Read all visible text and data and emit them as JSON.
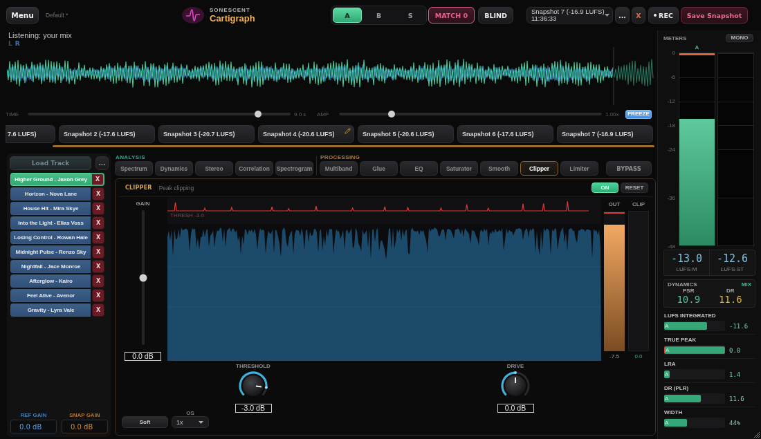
{
  "header": {
    "menu_button": "Menu",
    "preset": "Default *",
    "logo": {
      "brand": "SONESCENT",
      "product": "Cartigraph"
    },
    "compare": [
      {
        "label": "A",
        "selected": true
      },
      {
        "label": "B",
        "selected": false
      },
      {
        "label": "S",
        "selected": false
      }
    ],
    "match_button": {
      "label": "MATCH 0",
      "active": true
    },
    "blind_button": {
      "label": "BLIND",
      "active": false
    },
    "snapshot_select": {
      "value": "Snapshot 7 (-16.9 LUFS)  11:36:33"
    },
    "more_button": "...",
    "clear_button": "X",
    "rec_button": "REC",
    "save_button": "Save Snapshot"
  },
  "listening": "Listening: your mix",
  "channel_legend": [
    {
      "label": "L",
      "color": "#34566a"
    },
    {
      "label": "R",
      "color": "#3f73b8"
    }
  ],
  "transport": {
    "time": {
      "label": "TIME",
      "level": 0.876,
      "reading": "9.0 s"
    },
    "amp": {
      "label": "AMP",
      "level": 0.2,
      "reading": "1.00x"
    },
    "freeze_button": "FREEZE"
  },
  "snapshots": [
    {
      "label": "7.6 LUFS)",
      "edit_icon": false
    },
    {
      "label": "Snapshot 2 (-17.6 LUFS)",
      "edit_icon": false
    },
    {
      "label": "Snapshot 3 (-20.7 LUFS)",
      "edit_icon": false
    },
    {
      "label": "Snapshot 4 (-20.6 LUFS)",
      "edit_icon": true
    },
    {
      "label": "Snapshot 5 (-20.6 LUFS)",
      "edit_icon": false
    },
    {
      "label": "Snapshot 6 (-17.6 LUFS)",
      "edit_icon": false
    },
    {
      "label": "Snapshot 7 (-16.9 LUFS)",
      "edit_icon": false
    }
  ],
  "library": {
    "load_button": {
      "label": "Load Track",
      "disabled": true
    },
    "more_button": "...",
    "tracks": [
      {
        "title": "Higher Ground - Jaxon Grey",
        "remove": "X",
        "selected": true
      },
      {
        "title": "Horizon - Nova Lane",
        "remove": "X",
        "selected": false
      },
      {
        "title": "House Hit - Mira Skye",
        "remove": "X",
        "selected": false
      },
      {
        "title": "Into the Light - Elias Voss",
        "remove": "X",
        "selected": false
      },
      {
        "title": "Losing Control - Rowan Hale",
        "remove": "X",
        "selected": false
      },
      {
        "title": "Midnight Pulse - Renzo Sky",
        "remove": "X",
        "selected": false
      },
      {
        "title": "Nightfall - Jace Monroe",
        "remove": "X",
        "selected": false
      },
      {
        "title": "Afterglow - Kairo",
        "remove": "X",
        "selected": false
      },
      {
        "title": "Feel Alive - Avenor",
        "remove": "X",
        "selected": false
      },
      {
        "title": "Gravity - Lyra Vale",
        "remove": "X",
        "selected": false
      }
    ],
    "ref_gain": {
      "label": "REF GAIN",
      "value": "0.0 dB"
    },
    "snap_gain": {
      "label": "SNAP GAIN",
      "value": "0.0 dB"
    }
  },
  "analysis": {
    "label": "ANALYSIS",
    "tabs": [
      {
        "label": "Spectrum",
        "selected": false
      },
      {
        "label": "Dynamics",
        "selected": false
      },
      {
        "label": "Stereo",
        "selected": false
      },
      {
        "label": "Correlation",
        "selected": false
      },
      {
        "label": "Spectrogram",
        "selected": false
      }
    ]
  },
  "processing": {
    "label": "PROCESSING",
    "tabs": [
      {
        "label": "Multiband",
        "selected": false
      },
      {
        "label": "Glue",
        "selected": false
      },
      {
        "label": "EQ",
        "selected": false
      },
      {
        "label": "Saturator",
        "selected": false
      },
      {
        "label": "Smooth",
        "selected": false
      },
      {
        "label": "Clipper",
        "selected": true
      },
      {
        "label": "Limiter",
        "selected": false
      }
    ]
  },
  "bypass_button": "BYPASS",
  "module": {
    "title": "CLIPPER",
    "subtitle": "Peak clipping",
    "on_button": {
      "label": "ON",
      "on": true
    },
    "reset_button": "RESET",
    "gain": {
      "label": "GAIN",
      "level": 0.5,
      "value": "0.0 dB"
    },
    "display": {
      "threshold_label": "THRESH -3.0"
    },
    "out_meter": {
      "label": "OUT",
      "level": 0.92,
      "peak": true,
      "reading": "-7.5"
    },
    "clip_meter": {
      "label": "CLIP",
      "reading": "0.0"
    },
    "threshold": {
      "label": "THRESHOLD",
      "level": 0.86,
      "value": "-3.0 dB"
    },
    "drive": {
      "label": "DRIVE",
      "level": 0.5,
      "value": "0.0 dB"
    },
    "mode_button": "Soft",
    "oversampling": {
      "label": "OS",
      "value": "1x"
    }
  },
  "meters": {
    "title": "METERS",
    "mono_button": "MONO",
    "scale": [
      "0",
      "-6",
      "-12",
      "-18",
      "-24",
      "-36",
      "-48"
    ],
    "channels": [
      {
        "label": "A",
        "level": 0.66,
        "peak": true
      },
      {
        "peak": false
      }
    ],
    "readouts": [
      {
        "value": "-13.0",
        "label": "LUFS-M"
      },
      {
        "value": "-12.6",
        "label": "LUFS-ST"
      }
    ],
    "dynamics": {
      "title": "DYNAMICS",
      "mode": "MIX",
      "items": [
        {
          "label": "PSR",
          "value": "10.9",
          "color": "#4fc39a"
        },
        {
          "label": "DR",
          "value": "11.6",
          "color": "#e0b43a"
        }
      ]
    },
    "stats": [
      {
        "label": "LUFS INTEGRATED",
        "tag": "A",
        "level": 0.71,
        "value": "-11.6",
        "over": false
      },
      {
        "label": "TRUE PEAK",
        "tag": "A",
        "level": 1.0,
        "value": "0.0",
        "over": true
      },
      {
        "label": "LRA",
        "tag": "A",
        "level": 0.09,
        "value": "1.4",
        "over": false
      },
      {
        "label": "DR (PLR)",
        "tag": "A",
        "level": 0.6,
        "value": "11.6",
        "over": false
      },
      {
        "label": "WIDTH",
        "tag": "A",
        "level": 0.38,
        "value": "44%",
        "over": false
      }
    ]
  }
}
